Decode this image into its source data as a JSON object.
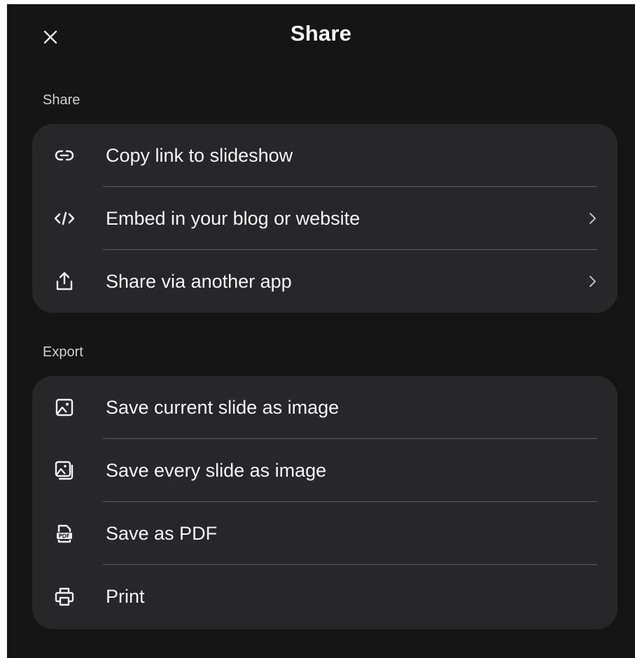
{
  "dialog": {
    "title": "Share",
    "close_icon": "close-icon"
  },
  "share_section": {
    "label": "Share",
    "items": [
      {
        "label": "Copy link to slideshow",
        "icon": "link-icon",
        "has_chevron": false
      },
      {
        "label": "Embed in your blog or website",
        "icon": "code-icon",
        "has_chevron": true
      },
      {
        "label": "Share via another app",
        "icon": "share-upload-icon",
        "has_chevron": true
      }
    ]
  },
  "export_section": {
    "label": "Export",
    "items": [
      {
        "label": "Save current slide as image",
        "icon": "image-icon",
        "has_chevron": false
      },
      {
        "label": "Save every slide as image",
        "icon": "images-stack-icon",
        "has_chevron": false
      },
      {
        "label": "Save as PDF",
        "icon": "pdf-file-icon",
        "has_chevron": false
      },
      {
        "label": "Print",
        "icon": "printer-icon",
        "has_chevron": false
      }
    ]
  },
  "colors": {
    "background": "#151515",
    "card": "#27272a",
    "divider": "#5a5a5e",
    "text": "#f4f4f4",
    "section_label": "#cfcfcf"
  }
}
